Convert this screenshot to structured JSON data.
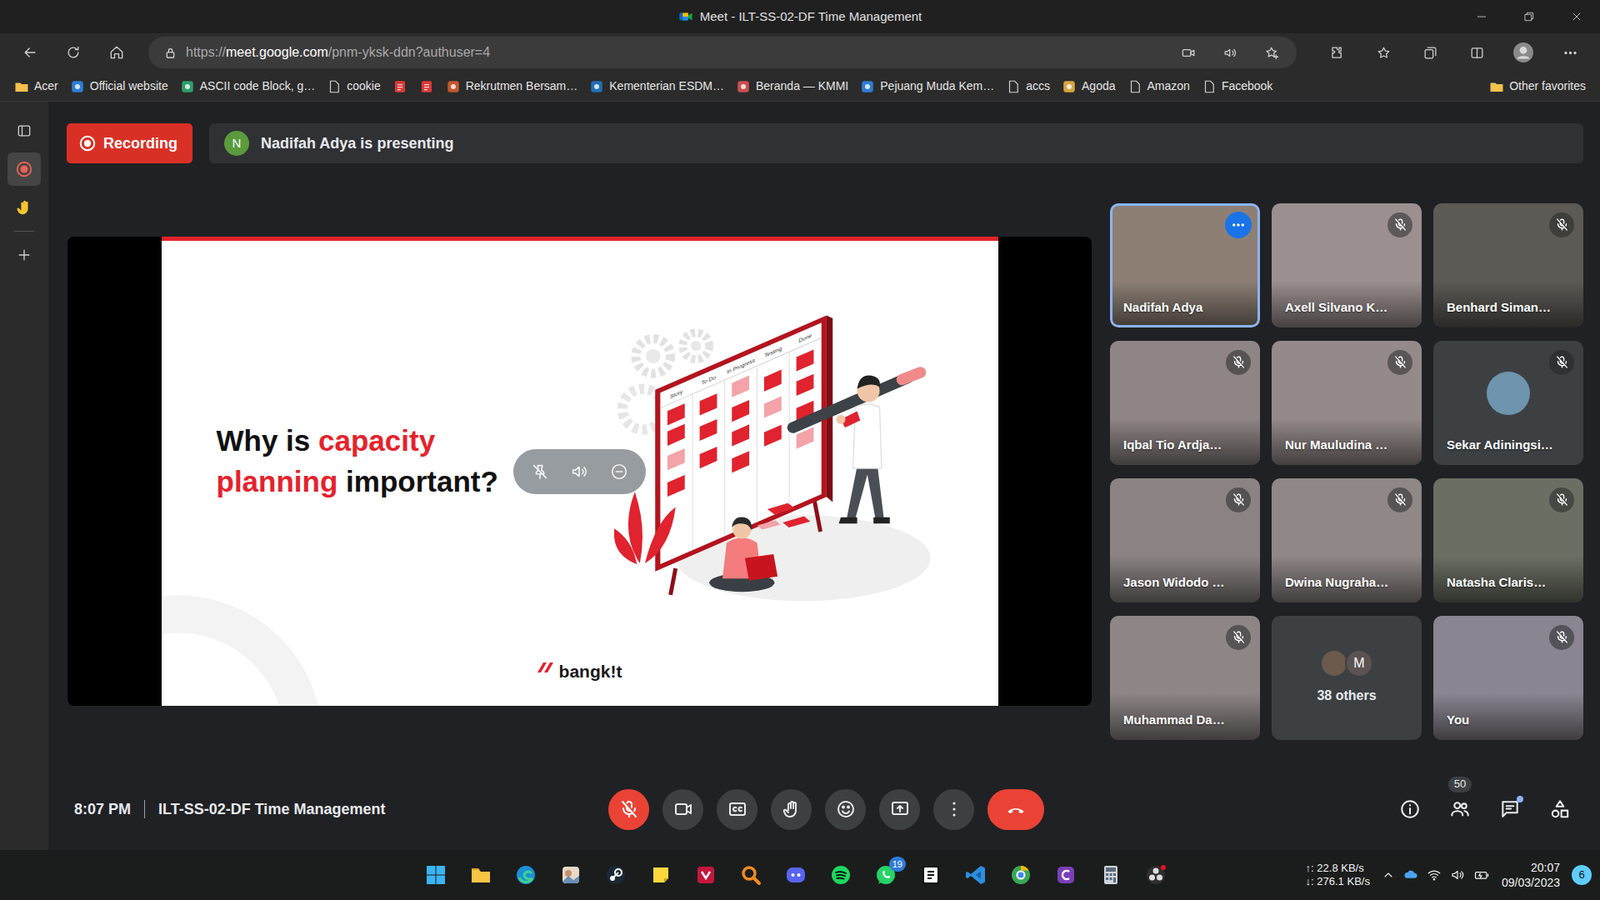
{
  "window": {
    "title": "Meet - ILT-SS-02-DF Time Management"
  },
  "address_bar": {
    "scheme": "https://",
    "host": "meet.google.com",
    "path": "/pnm-yksk-ddn?authuser=4"
  },
  "bookmarks": [
    {
      "kind": "folder",
      "label": "Acer"
    },
    {
      "kind": "site",
      "label": "Official website"
    },
    {
      "kind": "site",
      "label": "ASCII code Block, g…"
    },
    {
      "kind": "page",
      "label": "cookie"
    },
    {
      "kind": "pdf"
    },
    {
      "kind": "pdf"
    },
    {
      "kind": "site",
      "label": "Rekrutmen Bersam…"
    },
    {
      "kind": "site",
      "label": "Kementerian ESDM…"
    },
    {
      "kind": "site",
      "label": "Beranda — KMMI"
    },
    {
      "kind": "site",
      "label": "Pejuang Muda Kem…"
    },
    {
      "kind": "page",
      "label": "accs"
    },
    {
      "kind": "site",
      "label": "Agoda"
    },
    {
      "kind": "page",
      "label": "Amazon"
    },
    {
      "kind": "page",
      "label": "Facebook"
    }
  ],
  "other_favorites": {
    "label": "Other favorites"
  },
  "sidebar": [
    {
      "kind": "tabs",
      "selected": false
    },
    {
      "kind": "record",
      "selected": true
    },
    {
      "kind": "hand",
      "selected": false
    },
    {
      "kind": "add",
      "selected": false
    }
  ],
  "recording": {
    "label": "Recording"
  },
  "presenting": {
    "avatar_letter": "N",
    "text": "Nadifah Adya is presenting"
  },
  "slide": {
    "title_lines": [
      [
        {
          "text": "Why is ",
          "accent": false
        },
        {
          "text": "capacity",
          "accent": true
        }
      ],
      [
        {
          "text": "planning",
          "accent": true
        },
        {
          "text": " important?",
          "accent": false
        }
      ]
    ],
    "board_columns": [
      "Story",
      "To Do",
      "In Progress",
      "Testing",
      "Done"
    ],
    "logo": "bangk!t"
  },
  "tiles": [
    {
      "kind": "camera",
      "name": "Nadifah Adya",
      "muted": false,
      "highlighted": true
    },
    {
      "kind": "camera",
      "name": "Axell Silvano K…",
      "muted": true,
      "highlighted": false
    },
    {
      "kind": "camera",
      "name": "Benhard Siman…",
      "muted": true,
      "highlighted": false
    },
    {
      "kind": "camera",
      "name": "Iqbal Tio Ardja…",
      "muted": true,
      "highlighted": false
    },
    {
      "kind": "camera",
      "name": "Nur Mauludina …",
      "muted": true,
      "highlighted": false
    },
    {
      "kind": "avatar",
      "name": "Sekar Adiningsi…",
      "muted": true,
      "highlighted": false
    },
    {
      "kind": "camera",
      "name": "Jason Widodo …",
      "muted": true,
      "highlighted": false
    },
    {
      "kind": "camera",
      "name": "Dwina Nugraha…",
      "muted": true,
      "highlighted": false
    },
    {
      "kind": "camera",
      "name": "Natasha Claris…",
      "muted": true,
      "highlighted": false
    },
    {
      "kind": "camera",
      "name": "Muhammad Da…",
      "muted": true,
      "highlighted": false
    },
    {
      "kind": "others",
      "label": "38 others",
      "avatar_letter": "M",
      "muted": false,
      "highlighted": false
    },
    {
      "kind": "self",
      "name": "You",
      "muted": true,
      "highlighted": false
    }
  ],
  "meeting_bar": {
    "time": "8:07 PM",
    "title": "ILT-SS-02-DF Time Management",
    "controls": [
      {
        "kind": "mic",
        "off": true
      },
      {
        "kind": "camera",
        "off": false
      },
      {
        "kind": "captions",
        "off": false
      },
      {
        "kind": "hand",
        "off": false
      },
      {
        "kind": "emoji",
        "off": false
      },
      {
        "kind": "present",
        "off": false
      },
      {
        "kind": "more",
        "off": false
      },
      {
        "kind": "leave",
        "off": false
      }
    ],
    "side_buttons": [
      {
        "kind": "info",
        "unread": false
      },
      {
        "kind": "people",
        "badge": "50",
        "unread": false
      },
      {
        "kind": "chat",
        "unread": true
      },
      {
        "kind": "activities",
        "unread": false
      }
    ]
  },
  "taskbar": {
    "apps": [
      {
        "kind": "start"
      },
      {
        "kind": "explorer"
      },
      {
        "kind": "edge"
      },
      {
        "kind": "photos"
      },
      {
        "kind": "steam"
      },
      {
        "kind": "sticky"
      },
      {
        "kind": "snip"
      },
      {
        "kind": "magnifier"
      },
      {
        "kind": "discord"
      },
      {
        "kind": "spotify"
      },
      {
        "kind": "whatsapp",
        "badge": "19"
      },
      {
        "kind": "notion"
      },
      {
        "kind": "vscode"
      },
      {
        "kind": "globe"
      },
      {
        "kind": "purple"
      },
      {
        "kind": "calculator"
      },
      {
        "kind": "obs"
      }
    ],
    "net_up": "↑: 22.8 KB/s",
    "net_down": "↓: 276.1 KB/s",
    "time": "20:07",
    "date": "09/03/2023",
    "notifications": "6"
  }
}
